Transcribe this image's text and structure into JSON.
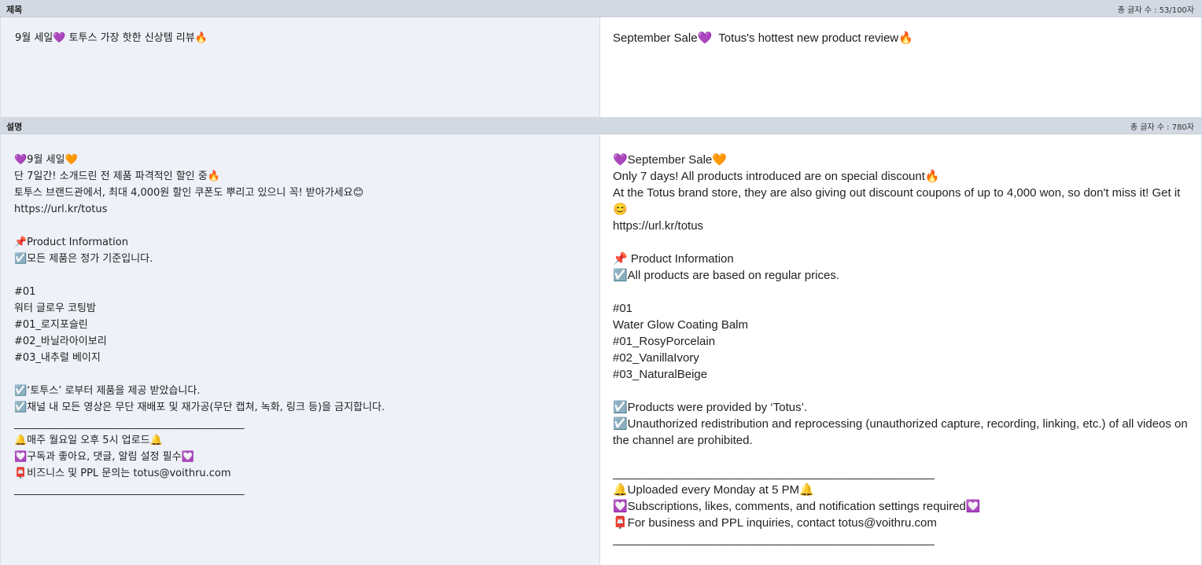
{
  "title_section": {
    "label": "제목",
    "count_text": "총 글자 수 : 53/100자",
    "left_text": "9월 세일💜 토투스 가장 핫한 신상템 리뷰🔥",
    "right_text": "September Sale💜  Totus's hottest new product review🔥"
  },
  "description_section": {
    "label": "설명",
    "count_text": "총 글자 수 : 780자",
    "left_text": "💜9월 세일🧡\n단 7일간! 소개드린 전 제품 파격적인 할인 중🔥\n토투스 브랜드관에서, 최대 4,000원 할인 쿠폰도 뿌리고 있으니 꼭! 받아가세요😊\nhttps://url.kr/totus\n\n📌Product Information\n☑️모든 제품은 정가 기준입니다.\n\n#01\n워터 글로우 코팅밤\n#01_로지포슬린\n#02_바닐라아이보리\n#03_내추럴 베이지\n\n☑️‘토투스’ 로부터 제품을 제공 받았습니다.\n☑️채널 내 모든 영상은 무단 재배포 및 재가공(무단 캡쳐, 녹화, 링크 등)을 금지합니다.\n_____________________________________________\n🔔매주 월요일 오후 5시 업로드🔔\n💟구독과 좋아요, 댓글, 알림 설정 필수💟\n📮비즈니스 및 PPL 문의는 totus@voithru.com\n_____________________________________________",
    "right_text": "💜September Sale🧡\nOnly 7 days! All products introduced are on special discount🔥\nAt the Totus brand store, they are also giving out discount coupons of up to 4,000 won, so don't miss it! Get it😊\nhttps://url.kr/totus\n\n📌 Product Information\n☑️All products are based on regular prices.\n\n#01\nWater Glow Coating Balm\n#01_RosyPorcelain\n#02_VanillaIvory\n#03_NaturalBeige\n\n☑️Products were provided by ‘Totus’.\n☑️Unauthorized redistribution and reprocessing (unauthorized capture, recording, linking, etc.) of all videos on the channel are prohibited.\n\n_________________________________________________\n🔔Uploaded every Monday at 5 PM🔔\n💟Subscriptions, likes, comments, and notification settings required💟\n📮For business and PPL inquiries, contact totus@voithru.com\n_________________________________________________"
  }
}
